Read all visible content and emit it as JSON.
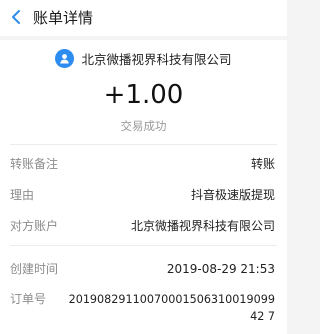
{
  "nav": {
    "back_icon": "chevron-left-icon",
    "title": "账单详情"
  },
  "payee": {
    "avatar_icon": "user-avatar-icon",
    "name": "北京微播视界科技有限公司"
  },
  "transaction": {
    "amount": "+1.00",
    "status": "交易成功"
  },
  "details": [
    {
      "label": "转账备注",
      "value": "转账"
    },
    {
      "label": "理由",
      "value": "抖音极速版提现"
    },
    {
      "label": "对方账户",
      "value": "北京微播视界科技有限公司"
    },
    {
      "label": "创建时间",
      "value": "2019-08-29 21:53"
    },
    {
      "label": "订单号",
      "value": "2019082911007000150631001909942 7"
    }
  ],
  "colors": {
    "accent": "#2d8cf0",
    "label_gray": "#8c8c8c",
    "status_gray": "#9a9a9a"
  }
}
